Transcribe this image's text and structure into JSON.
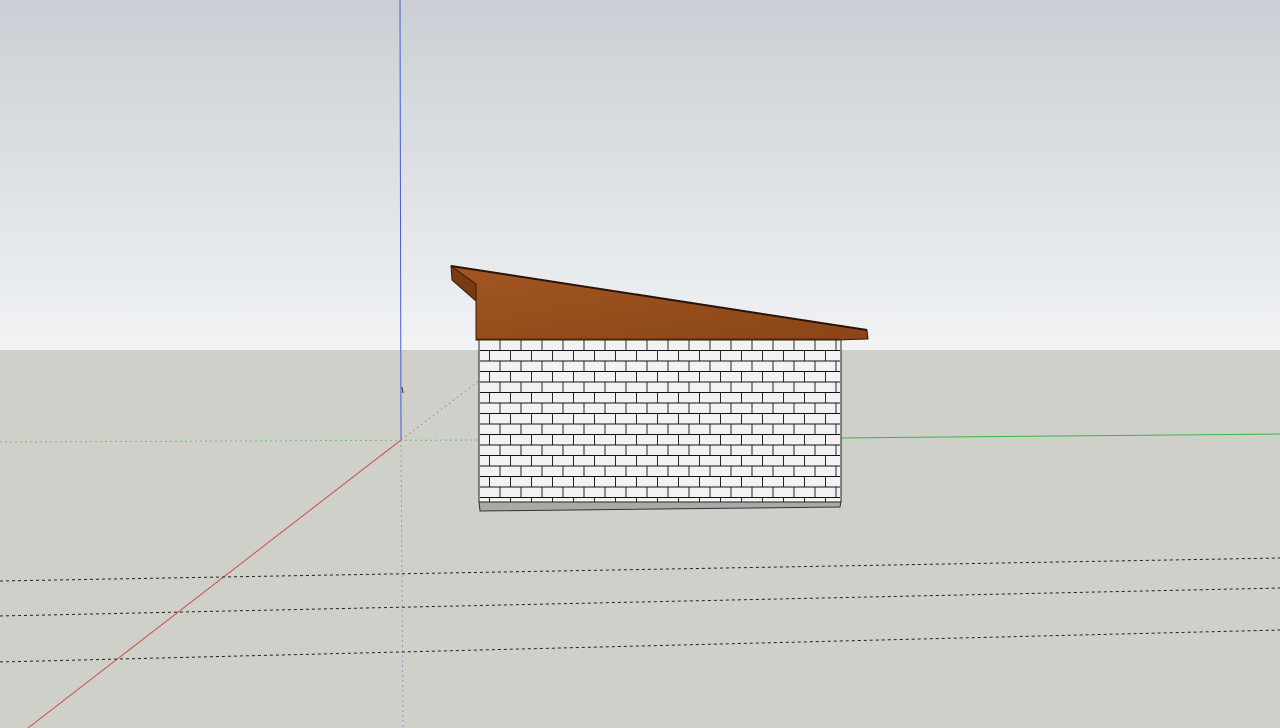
{
  "app": {
    "kind": "3D modeling viewport"
  },
  "scene": {
    "sky_top_color": "#c9cfd4",
    "sky_bottom_color": "#f1f3f5",
    "ground_color": "#cfd0ca",
    "axes": {
      "red_axis_color": "#d24b4b",
      "green_axis_color": "#3bb54a",
      "blue_axis_color": "#4a5bd0"
    },
    "model": {
      "roof_color": "#9a4f1e",
      "roof_edge_color": "#6f3410",
      "wall_color": "#f2f2f2",
      "brick_line_color": "#111111",
      "base_color": "#a9aaa6"
    },
    "guide_lines": {
      "color": "#222222",
      "style": "dashed"
    }
  }
}
